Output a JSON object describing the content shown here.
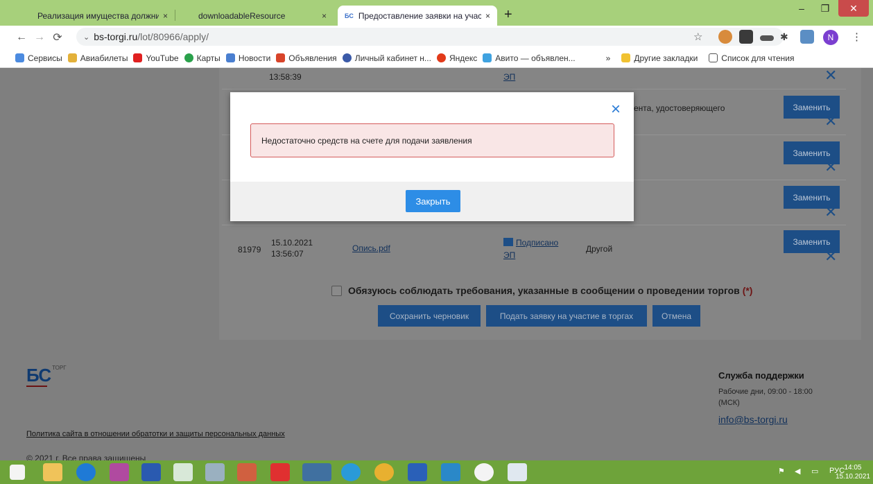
{
  "browser": {
    "tabs": [
      {
        "title": "Реализация имущества должни",
        "close": "×"
      },
      {
        "title": "downloadableResource",
        "close": "×"
      },
      {
        "title": "Предоставление заявки на учас",
        "close": "×",
        "favicon": "БС"
      }
    ],
    "new_tab": "+",
    "url_host": "bs-torgi.ru",
    "url_path": "/lot/80966/apply/",
    "profile_initial": "N",
    "bookmarks": [
      "Сервисы",
      "Авиабилеты",
      "YouTube",
      "Карты",
      "Новости",
      "Объявления",
      "Личный кабинет н...",
      "Яндекс",
      "Авито — объявлен..."
    ],
    "bookmarks_more": "»",
    "other_bookmarks": "Другие закладки",
    "reading_list": "Список для чтения"
  },
  "page": {
    "row0": {
      "time": "13:58:39",
      "sign": "ЭП"
    },
    "row1": {
      "type": "ента, удостоверяющего"
    },
    "row_last": {
      "id": "81979",
      "date": "15.10.2021",
      "time": "13:56:07",
      "file": "Опись.pdf",
      "signed": "Подписано",
      "sign": "ЭП",
      "type": "Другой"
    },
    "replace_label": "Заменить",
    "agree_text": "Обязуюсь соблюдать требования, указанные в сообщении о проведении торгов",
    "agree_req": "(*)",
    "buttons": {
      "save_draft": "Сохранить черновик",
      "submit": "Подать заявку на участие в торгах",
      "cancel": "Отмена"
    }
  },
  "modal": {
    "message": "Недостаточно средств на счете для подачи заявления",
    "close_label": "Закрыть",
    "close_icon": "×"
  },
  "footer": {
    "logo": "БС",
    "logo_sub": "ТОРГ",
    "policy": "Политика сайта в отношении обратотки и защиты персональных данных",
    "copyright": "© 2021 г. Все права защищены",
    "support_title": "Служба поддержки",
    "support_hours": "Рабочие дни, 09:00 - 18:00 (МСК)",
    "support_email": "info@bs-torgi.ru"
  },
  "taskbar": {
    "lang": "РУС",
    "time": "14:05",
    "date": "15.10.2021"
  }
}
